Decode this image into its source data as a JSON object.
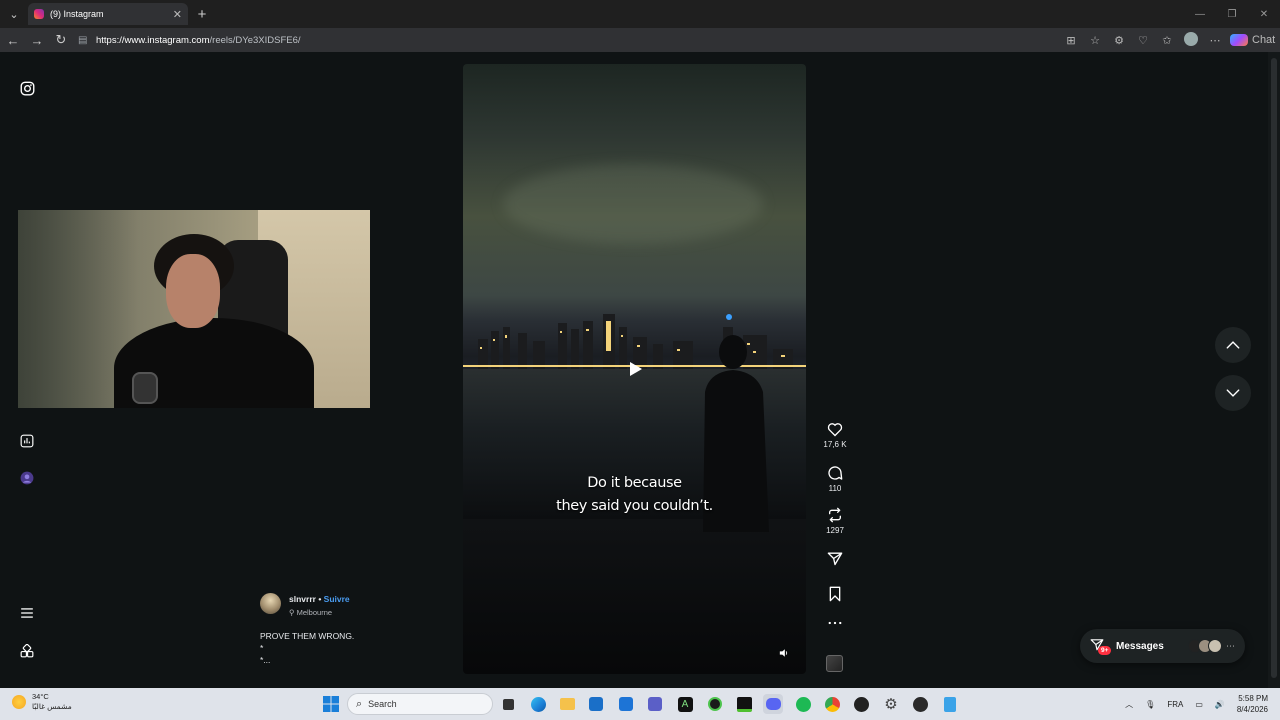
{
  "browser": {
    "tab_title": "(9) Instagram",
    "new_tab_symbol": "+",
    "url_host": "https://www.instagram.com",
    "url_path": "/reels/DYe3XIDSFE6/",
    "chat_label": "Chat"
  },
  "reel": {
    "caption_line1": "Do it because",
    "caption_line2": "they said you couldn’t.",
    "likes": "17,6 K",
    "comments": "110",
    "reposts": "1297"
  },
  "author": {
    "username": "slnvrrr",
    "separator": "•",
    "follow_label": "Suivre",
    "location": "Melbourne",
    "description_line1": "PROVE THEM WRONG.",
    "description_line2": "*",
    "description_line3": "*..."
  },
  "messages": {
    "label": "Messages",
    "badge": "9+"
  },
  "taskbar": {
    "weather_temp": "34°C",
    "weather_desc": "مشمس غالبًا",
    "search_placeholder": "Search",
    "language": "FRA",
    "time": "5:58 PM",
    "date": "8/4/2026"
  },
  "colors": {
    "follow_blue": "#4a9cf0",
    "badge_red": "#ff3040",
    "page_bg": "#0f1314"
  }
}
